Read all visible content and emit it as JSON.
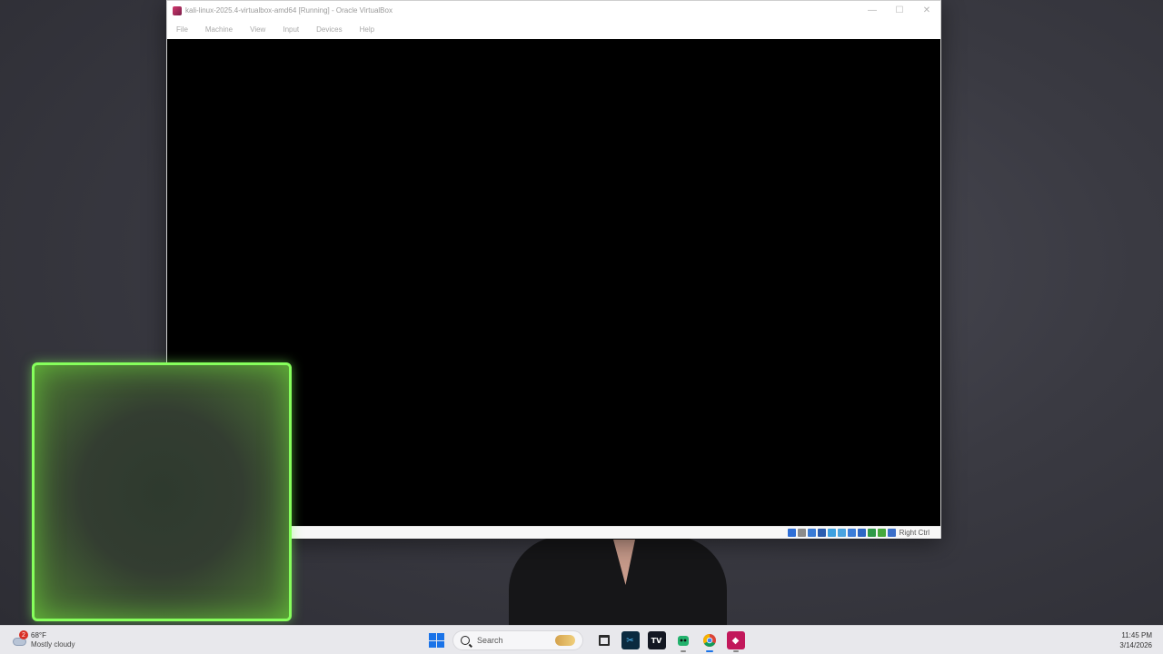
{
  "vbox": {
    "title": "kali-linux-2025.4-virtualbox-amd64 [Running] - Oracle VirtualBox",
    "controls": {
      "minimize": "—",
      "maximize": "☐",
      "close": "✕"
    },
    "menu": [
      "File",
      "Machine",
      "View",
      "Input",
      "Devices",
      "Help"
    ],
    "status_icons": [
      "hard-disk-icon",
      "optical-drive-icon",
      "audio-icon",
      "network-icon",
      "usb-icon",
      "shared-folders-icon",
      "display-icon",
      "recording-icon",
      "cpu-icon",
      "mouse-integration-icon",
      "keyboard-icon"
    ],
    "host_key": "Right Ctrl"
  },
  "taskbar": {
    "weather": {
      "badge": "2",
      "temperature": "68°F",
      "condition": "Mostly cloudy"
    },
    "search_placeholder": "Search",
    "apps": [
      {
        "name": "file-explorer",
        "glyph": ""
      },
      {
        "name": "capcut",
        "glyph": "✂"
      },
      {
        "name": "tradingview",
        "glyph": "TV"
      },
      {
        "name": "android-app",
        "glyph": "●"
      },
      {
        "name": "chrome",
        "glyph": ""
      },
      {
        "name": "virtualbox",
        "glyph": "◆"
      }
    ],
    "clock": {
      "time": "11:45 PM",
      "date": "3/14/2026"
    }
  },
  "colors": {
    "highlight": "#86ff5c",
    "windows_blue": "#1a73e8",
    "vm_screen": "#000000"
  }
}
